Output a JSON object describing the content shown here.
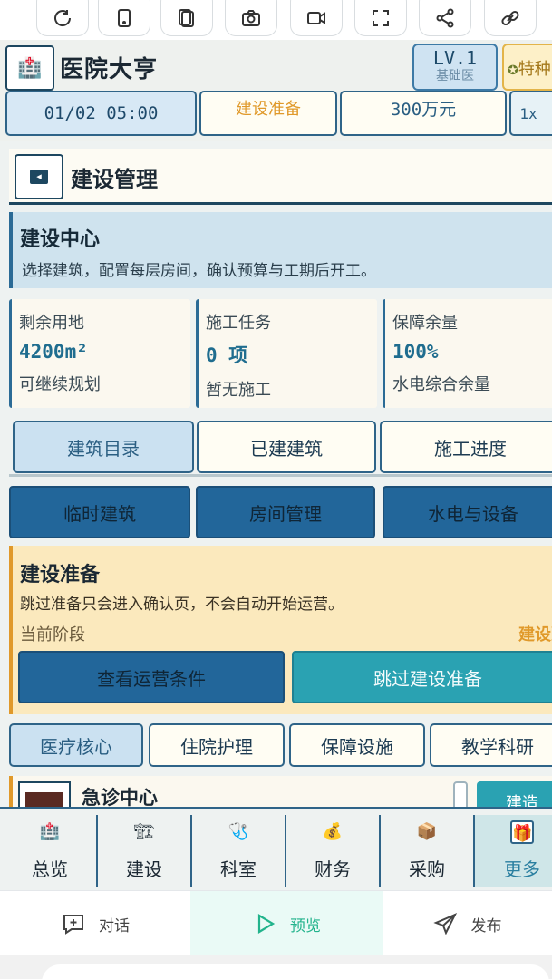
{
  "toolbar": {
    "icons": [
      "refresh-icon",
      "mobile-icon",
      "copy-icon",
      "camera-icon",
      "video-icon",
      "fullscreen-icon",
      "share-icon",
      "link-icon"
    ]
  },
  "header": {
    "title": "医院大亨",
    "level": "LV.1",
    "level_sub": "基础医",
    "vip": "特种",
    "date_time": "01/02 05:00",
    "phase": "建设准备",
    "money": "300万元",
    "speed": "1x"
  },
  "panel": {
    "title": "建设管理"
  },
  "center": {
    "title": "建设中心",
    "description": "选择建筑，配置每层房间，确认预算与工期后开工。"
  },
  "metrics": [
    {
      "label": "剩余用地",
      "value": "4200m²",
      "sub": "可继续规划"
    },
    {
      "label": "施工任务",
      "value": "0 项",
      "sub": "暂无施工"
    },
    {
      "label": "保障余量",
      "value": "100%",
      "sub": "水电综合余量"
    }
  ],
  "tabs": [
    "建筑目录",
    "已建建筑",
    "施工进度"
  ],
  "actions": [
    "临时建筑",
    "房间管理",
    "水电与设备"
  ],
  "prep": {
    "title": "建设准备",
    "description": "跳过准备只会进入确认页，不会自动开始运营。",
    "stage_label": "当前阶段",
    "stage_value": "建设准备",
    "view_button": "查看运营条件",
    "skip_button": "跳过建设准备"
  },
  "categories": [
    "医疗核心",
    "住院护理",
    "保障设施",
    "教学科研"
  ],
  "building": {
    "name": "急诊中心",
    "button": "建造"
  },
  "game_nav": [
    "总览",
    "建设",
    "科室",
    "财务",
    "采购",
    "更多"
  ],
  "app_bar": {
    "chat": "对话",
    "preview": "预览",
    "publish": "发布"
  },
  "colors": {
    "primary": "#22669a",
    "accent": "#2aa2b2",
    "warning": "#e0992a",
    "active_green": "#22b38c"
  }
}
